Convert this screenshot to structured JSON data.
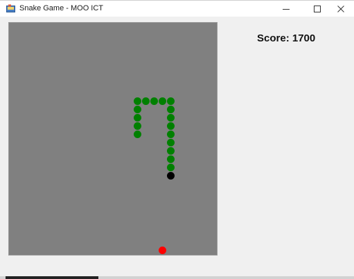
{
  "window": {
    "title": "Snake Game - MOO ICT",
    "minimize_icon": "minimize-icon",
    "maximize_icon": "maximize-icon",
    "close_icon": "close-icon"
  },
  "score": {
    "label": "Score:",
    "value": "1700"
  },
  "game": {
    "grid_cols": 25,
    "grid_rows": 28,
    "snake_head": {
      "col": 19,
      "row": 18
    },
    "snake_body": [
      {
        "col": 19,
        "row": 17
      },
      {
        "col": 19,
        "row": 16
      },
      {
        "col": 19,
        "row": 15
      },
      {
        "col": 19,
        "row": 14
      },
      {
        "col": 19,
        "row": 13
      },
      {
        "col": 19,
        "row": 12
      },
      {
        "col": 19,
        "row": 11
      },
      {
        "col": 19,
        "row": 10
      },
      {
        "col": 19,
        "row": 9
      },
      {
        "col": 18,
        "row": 9
      },
      {
        "col": 17,
        "row": 9
      },
      {
        "col": 16,
        "row": 9
      },
      {
        "col": 15,
        "row": 9
      },
      {
        "col": 15,
        "row": 10
      },
      {
        "col": 15,
        "row": 11
      },
      {
        "col": 15,
        "row": 12
      },
      {
        "col": 15,
        "row": 13
      }
    ],
    "food": {
      "col": 18,
      "row": 27
    },
    "colors": {
      "background": "#808080",
      "snake_body": "#008000",
      "snake_head": "#000000",
      "food": "#ff0000"
    }
  }
}
